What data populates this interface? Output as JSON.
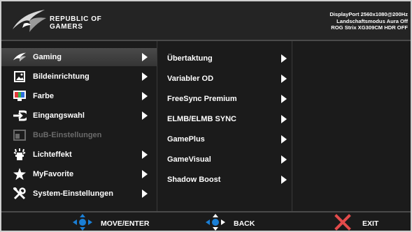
{
  "header": {
    "brand_line1": "REPUBLIC OF",
    "brand_line2": "GAMERS",
    "status_line1": "DisplayPort 2560x1080@200Hz",
    "status_line2": "Landschaftsmodus Aura Off",
    "status_line3": "ROG Strix XG309CM HDR OFF"
  },
  "main_menu": {
    "items": [
      {
        "label": "Gaming",
        "icon": "rog-eye-icon",
        "selected": true
      },
      {
        "label": "Bildeinrichtung",
        "icon": "picture-icon"
      },
      {
        "label": "Farbe",
        "icon": "color-icon"
      },
      {
        "label": "Eingangswahl",
        "icon": "input-icon"
      },
      {
        "label": "BuB-Einstellungen",
        "icon": "pip-icon",
        "disabled": true
      },
      {
        "label": "Lichteffekt",
        "icon": "light-icon"
      },
      {
        "label": "MyFavorite",
        "icon": "star-icon"
      },
      {
        "label": "System-Einstellungen",
        "icon": "tools-icon"
      }
    ]
  },
  "sub_menu": {
    "items": [
      {
        "label": "Übertaktung"
      },
      {
        "label": "Variabler OD"
      },
      {
        "label": "FreeSync Premium"
      },
      {
        "label": "ELMB/ELMB SYNC"
      },
      {
        "label": "GamePlus"
      },
      {
        "label": "GameVisual"
      },
      {
        "label": "Shadow Boost"
      }
    ]
  },
  "footer": {
    "move_label": "MOVE/ENTER",
    "back_label": "BACK",
    "exit_label": "EXIT"
  },
  "colors": {
    "background": "#1b1b1b",
    "joystick_blue": "#1a7fd6",
    "exit_red": "#e34b4b"
  }
}
